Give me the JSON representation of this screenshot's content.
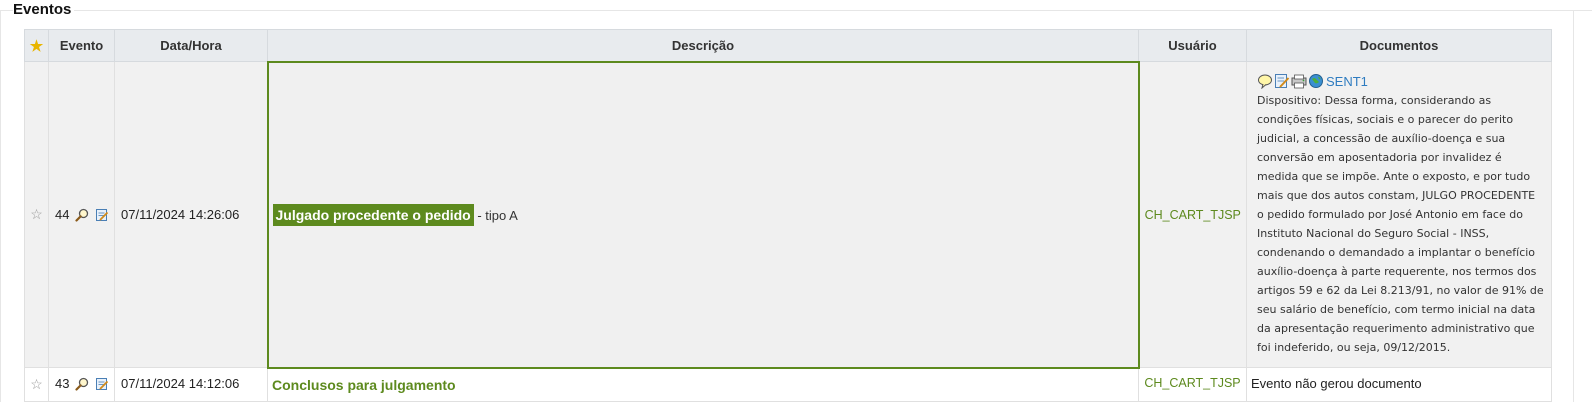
{
  "section": {
    "title": "Eventos"
  },
  "table": {
    "headers": {
      "evento": "Evento",
      "datahora": "Data/Hora",
      "descricao": "Descrição",
      "usuario": "Usuário",
      "documentos": "Documentos"
    },
    "rows": [
      {
        "evento": "44",
        "datahora": "07/11/2024 14:26:06",
        "descricao": "Julgado procedente o pedido",
        "descricao_suffix": "- tipo A",
        "usuario": "CH_CART_TJSP",
        "documento_link": "SENT1",
        "documento_texto": "Dispositivo: Dessa forma, considerando as condições físicas, sociais e o parecer do perito judicial, a concessão de auxílio-doença e sua conversão em aposentadoria por invalidez é medida que se impõe. Ante o exposto, e por tudo mais que dos autos constam, JULGO PROCEDENTE o pedido formulado por José Antonio em face do Instituto Nacional do Seguro Social - INSS, condenando o demandado a implantar o benefício auxílio-doença à parte requerente, nos termos dos artigos 59 e 62 da Lei 8.213/91, no valor de 91% de seu salário de benefício, com termo inicial na data da apresentação requerimento administrativo que foi indeferido, ou seja, 09/12/2015."
      },
      {
        "evento": "43",
        "datahora": "07/11/2024 14:12:06",
        "descricao": "Conclusos para julgamento",
        "usuario": "CH_CART_TJSP",
        "documento_texto": "Evento não gerou documento"
      }
    ]
  },
  "colors": {
    "accent_green": "#5d8a1e",
    "link_blue": "#2f7cc0",
    "star_gold": "#e8b500"
  }
}
